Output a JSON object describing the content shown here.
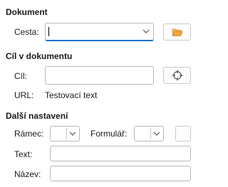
{
  "document": {
    "heading": "Dokument",
    "path_label": "Cesta:",
    "path_value": ""
  },
  "target": {
    "heading": "Cíl v dokumentu",
    "target_label": "Cíl:",
    "target_value": "",
    "url_label": "URL:",
    "url_value": "Testovací text"
  },
  "further": {
    "heading": "Další nastavení",
    "frame_label": "Rámec:",
    "form_label": "Formulář:",
    "text_label": "Text:",
    "text_value": "",
    "name_label": "Název:",
    "name_value": ""
  },
  "icons": {
    "browse": "folder-open-icon",
    "target": "crosshair-icon",
    "dropdown": "chevron-down-icon"
  },
  "colors": {
    "focus": "#1a73c8",
    "folder": "#e8a23a"
  }
}
